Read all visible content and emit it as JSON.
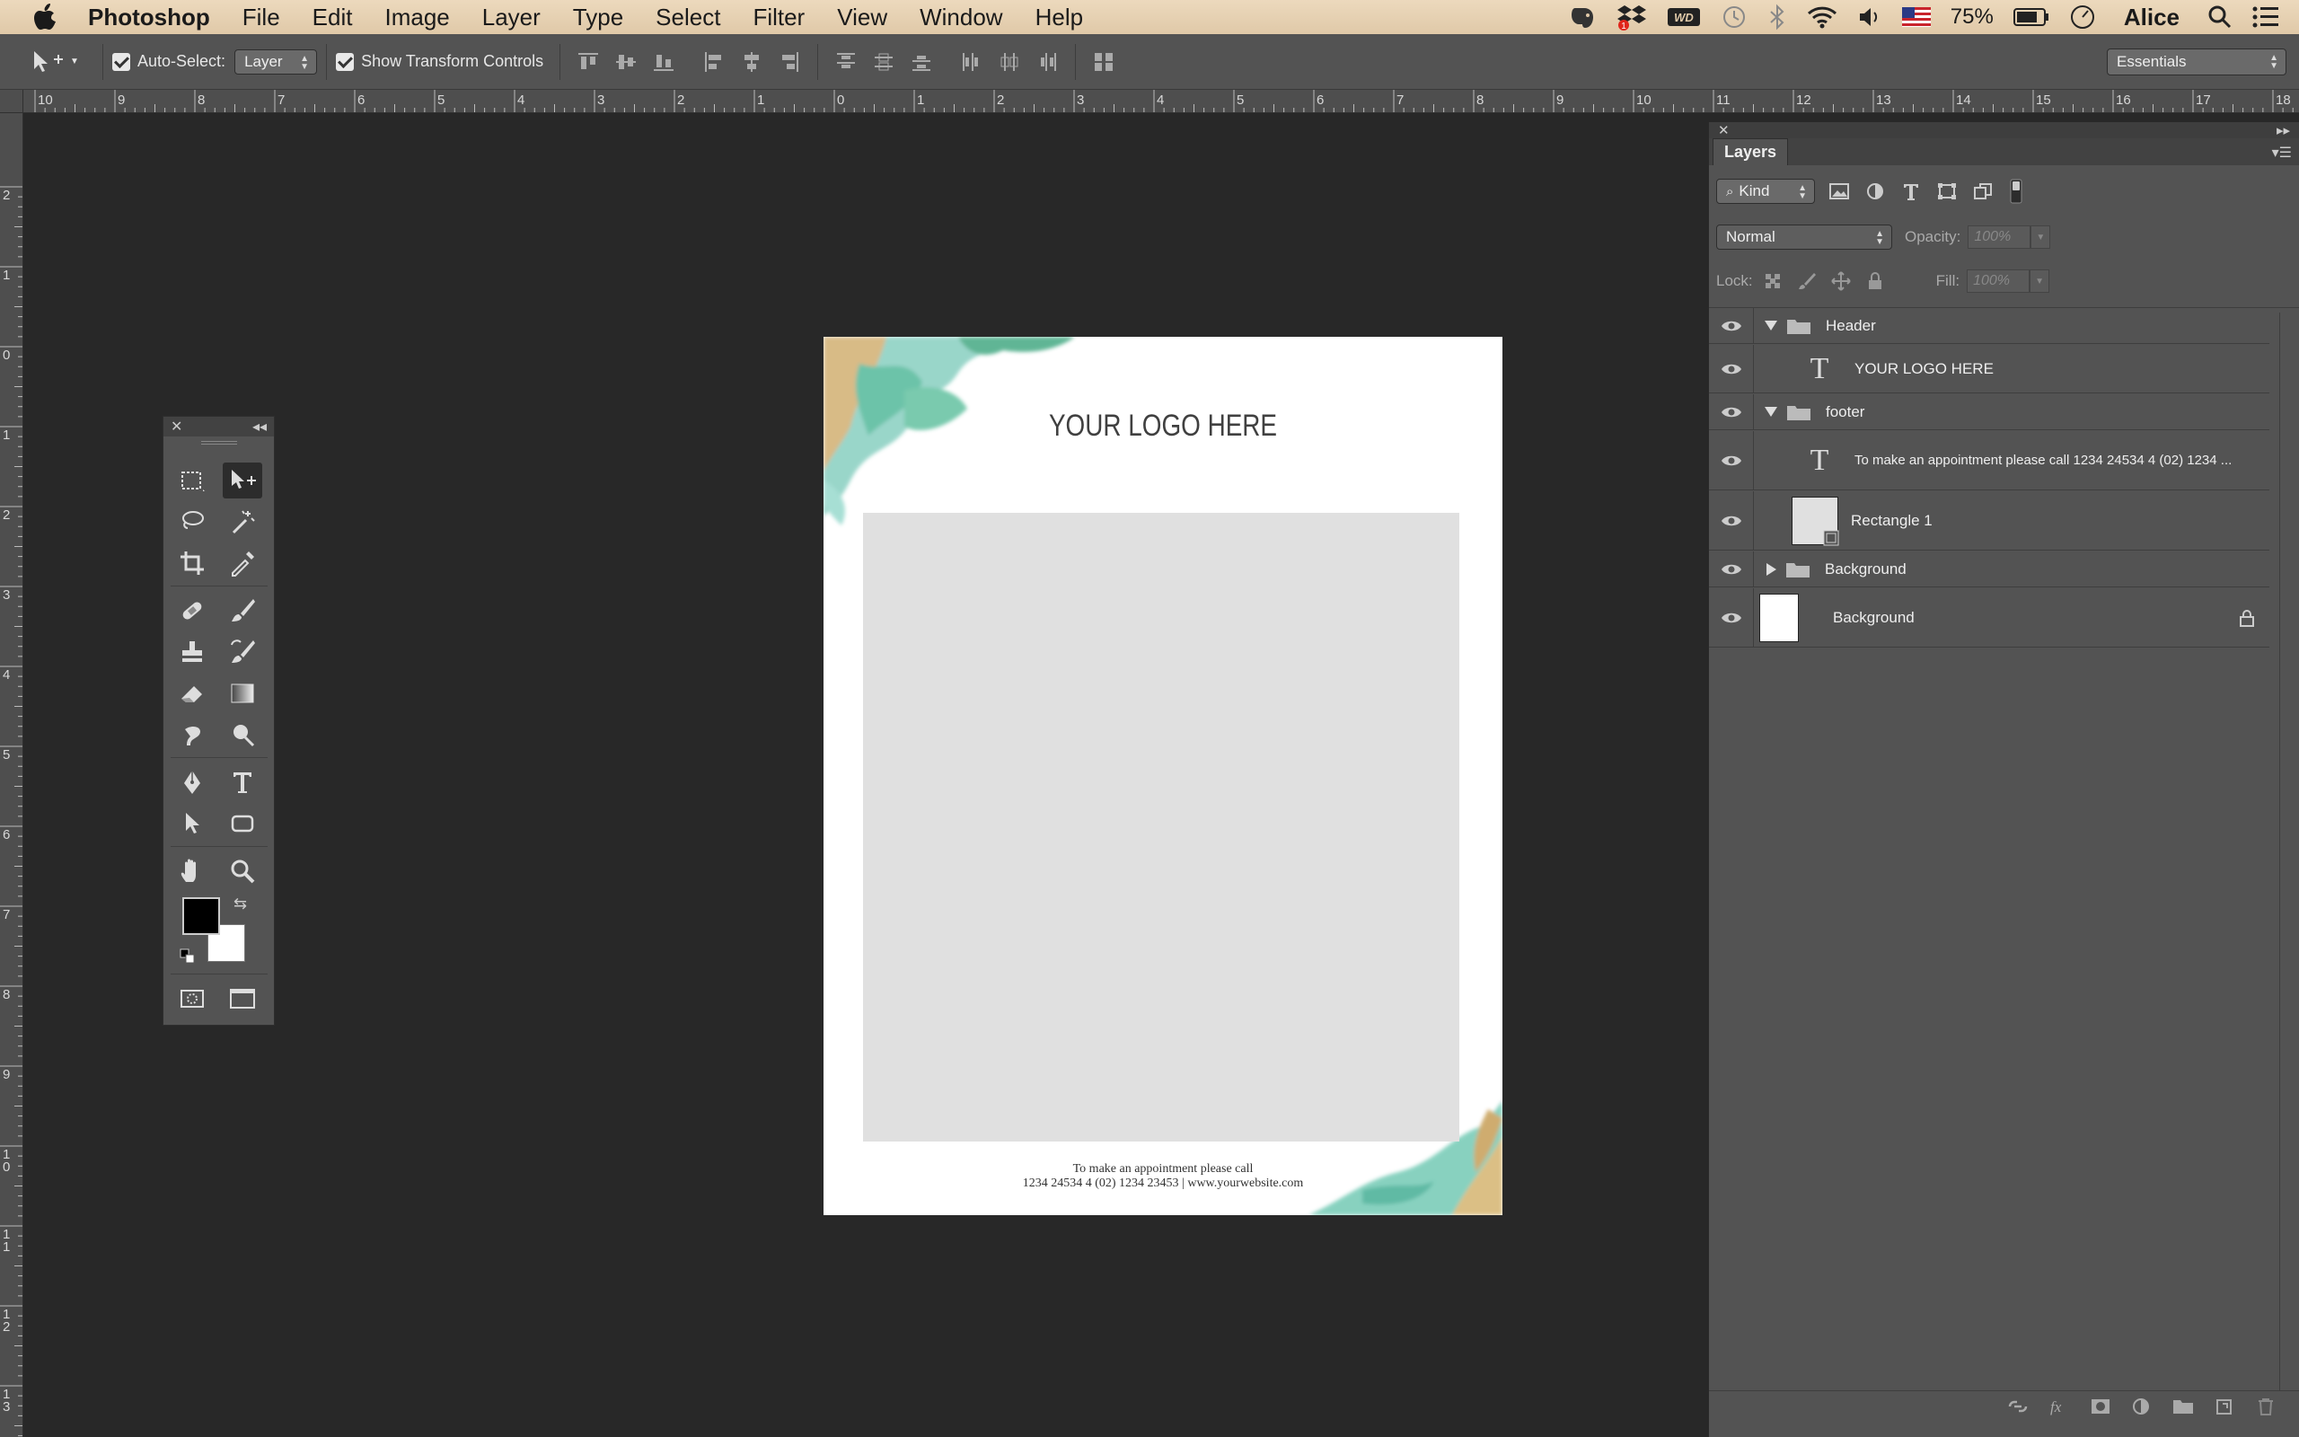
{
  "menubar": {
    "app_name": "Photoshop",
    "items": [
      "File",
      "Edit",
      "Image",
      "Layer",
      "Type",
      "Select",
      "Filter",
      "View",
      "Window",
      "Help"
    ],
    "battery": "75%",
    "user": "Alice"
  },
  "options_bar": {
    "auto_select_label": "Auto-Select:",
    "auto_select_value": "Layer",
    "show_transform_label": "Show Transform Controls",
    "workspace": "Essentials"
  },
  "rulers": {
    "h_labels": [
      "10",
      "9",
      "8",
      "7",
      "6",
      "5",
      "4",
      "3",
      "2",
      "1",
      "0",
      "1",
      "2",
      "3",
      "4",
      "5",
      "6",
      "7",
      "8",
      "9",
      "10",
      "11",
      "12",
      "13",
      "14",
      "15",
      "16",
      "17",
      "18"
    ],
    "v_labels": [
      "2",
      "1",
      "0",
      "1",
      "2",
      "3",
      "4",
      "5",
      "6",
      "7",
      "8",
      "9",
      "10",
      "11",
      "12",
      "13"
    ]
  },
  "document": {
    "logo_text": "YOUR LOGO HERE",
    "footer_line1": "To make an appointment please call",
    "footer_line2": "1234 24534 4 (02) 1234 23453 | www.yourwebsite.com"
  },
  "layers_panel": {
    "tab_label": "Layers",
    "filter_kind": "Kind",
    "blend_mode": "Normal",
    "opacity_label": "Opacity:",
    "opacity_value": "100%",
    "lock_label": "Lock:",
    "fill_label": "Fill:",
    "fill_value": "100%",
    "layers": [
      {
        "name": "Header",
        "kind": "group",
        "expanded": true
      },
      {
        "name": "YOUR LOGO HERE",
        "kind": "text"
      },
      {
        "name": "footer",
        "kind": "group",
        "expanded": true
      },
      {
        "name": "To make an appointment please call  1234 24534 4 (02) 1234 ...",
        "kind": "text"
      },
      {
        "name": "Rectangle 1",
        "kind": "shape"
      },
      {
        "name": "Background",
        "kind": "group",
        "expanded": false
      },
      {
        "name": "Background",
        "kind": "pixel",
        "locked": true
      }
    ]
  },
  "colors": {
    "menubar_bg": "#e6d1b3",
    "canvas_bg": "#282828",
    "panel_bg": "#535353",
    "foreground": "#000000",
    "background_swatch": "#ffffff",
    "splash_teal": "#6cc5b4",
    "splash_gold": "#c9a86a"
  }
}
